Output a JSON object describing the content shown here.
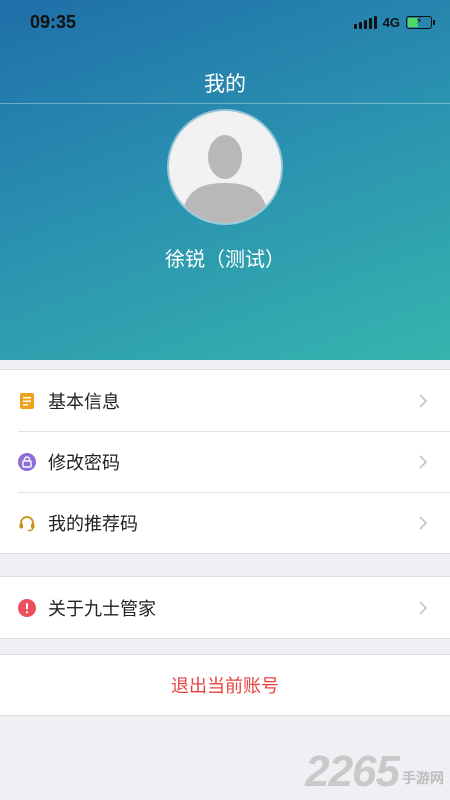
{
  "status_bar": {
    "time": "09:35",
    "network": "4G"
  },
  "header": {
    "title": "我的",
    "user_name": "徐锐（测试）"
  },
  "menu_groups": [
    {
      "items": [
        {
          "label": "基本信息",
          "icon": "document-icon",
          "icon_color": "#f0a11e"
        },
        {
          "label": "修改密码",
          "icon": "lock-icon",
          "icon_color": "#8e6fd8"
        },
        {
          "label": "我的推荐码",
          "icon": "headset-icon",
          "icon_color": "#c8901a"
        }
      ]
    },
    {
      "items": [
        {
          "label": "关于九士管家",
          "icon": "info-icon",
          "icon_color": "#ee4e5e"
        }
      ]
    }
  ],
  "logout": {
    "label": "退出当前账号",
    "color": "#e64340"
  },
  "watermark": {
    "number": "2265",
    "text": "手游网"
  }
}
